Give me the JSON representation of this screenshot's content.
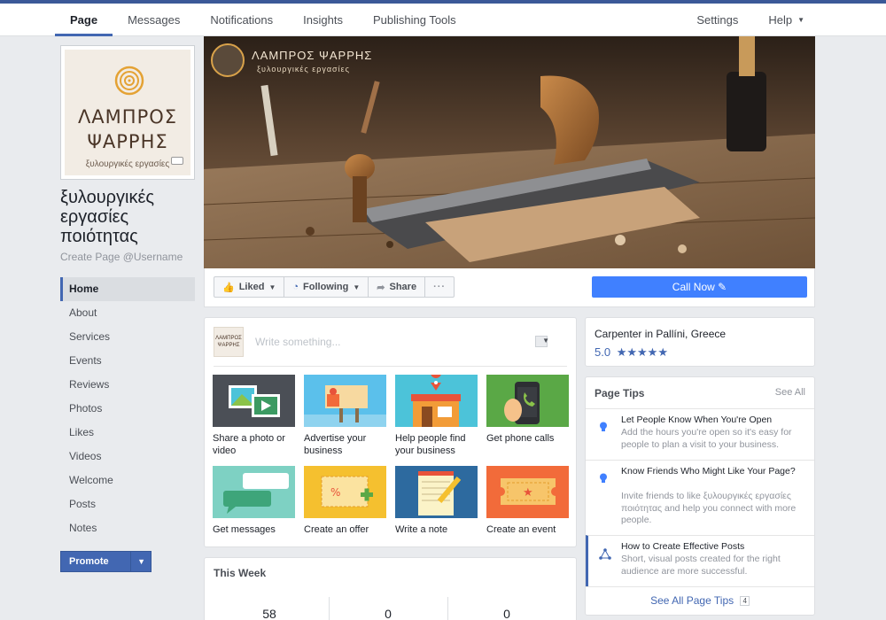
{
  "topnav": {
    "left": [
      "Page",
      "Messages",
      "Notifications",
      "Insights",
      "Publishing Tools"
    ],
    "settings": "Settings",
    "help": "Help"
  },
  "profile": {
    "logo_line1": "ΛΑΜΠΡΟΣ",
    "logo_line2": "ΨΑΡΡΗΣ",
    "logo_sub": "ξυλουργικές εργασίες"
  },
  "page": {
    "name": "ξυλουργικές εργασίες ποιότητας",
    "username_link": "Create Page @Username"
  },
  "sidebar": {
    "items": [
      "Home",
      "About",
      "Services",
      "Events",
      "Reviews",
      "Photos",
      "Likes",
      "Videos",
      "Welcome",
      "Posts",
      "Notes"
    ],
    "promote": "Promote"
  },
  "cover": {
    "title": "ΛΑΜΠΡΟΣ ΨΑΡΡΗΣ",
    "subtitle": "ξυλουργικές εργασίες"
  },
  "actions": {
    "liked": "Liked",
    "following": "Following",
    "share": "Share",
    "more": "···",
    "call_now": "Call Now"
  },
  "composer": {
    "avatar_line1": "ΛΑΜΠΡΟΣ",
    "avatar_line2": "ΨΑΡΡΗΣ",
    "placeholder": "Write something...",
    "tiles": [
      {
        "label": "Share a photo or video"
      },
      {
        "label": "Advertise your business"
      },
      {
        "label": "Help people find your business"
      },
      {
        "label": "Get phone calls"
      },
      {
        "label": "Get messages"
      },
      {
        "label": "Create an offer"
      },
      {
        "label": "Write a note"
      },
      {
        "label": "Create an event"
      }
    ]
  },
  "this_week": {
    "title": "This Week",
    "values": [
      "58",
      "0",
      "0"
    ]
  },
  "about": {
    "category": "Carpenter in Pallíni, Greece",
    "rating": "5.0",
    "stars": 5
  },
  "tips": {
    "title": "Page Tips",
    "see_all": "See All",
    "items": [
      {
        "title": "Let People Know When You're Open",
        "desc": "Add the hours you're open so it's easy for people to plan a visit to your business."
      },
      {
        "title": "Know Friends Who Might Like Your Page?",
        "desc": "Invite friends to like ξυλουργικές εργασίες ποιότητας and help you connect with more people."
      },
      {
        "title": "How to Create Effective Posts",
        "desc": "Short, visual posts created for the right audience are more successful."
      }
    ],
    "footer": "See All Page Tips",
    "count": "4"
  },
  "colors": {
    "brand": "#4267b2",
    "call_now": "#4080ff",
    "background": "#e9ebee"
  }
}
